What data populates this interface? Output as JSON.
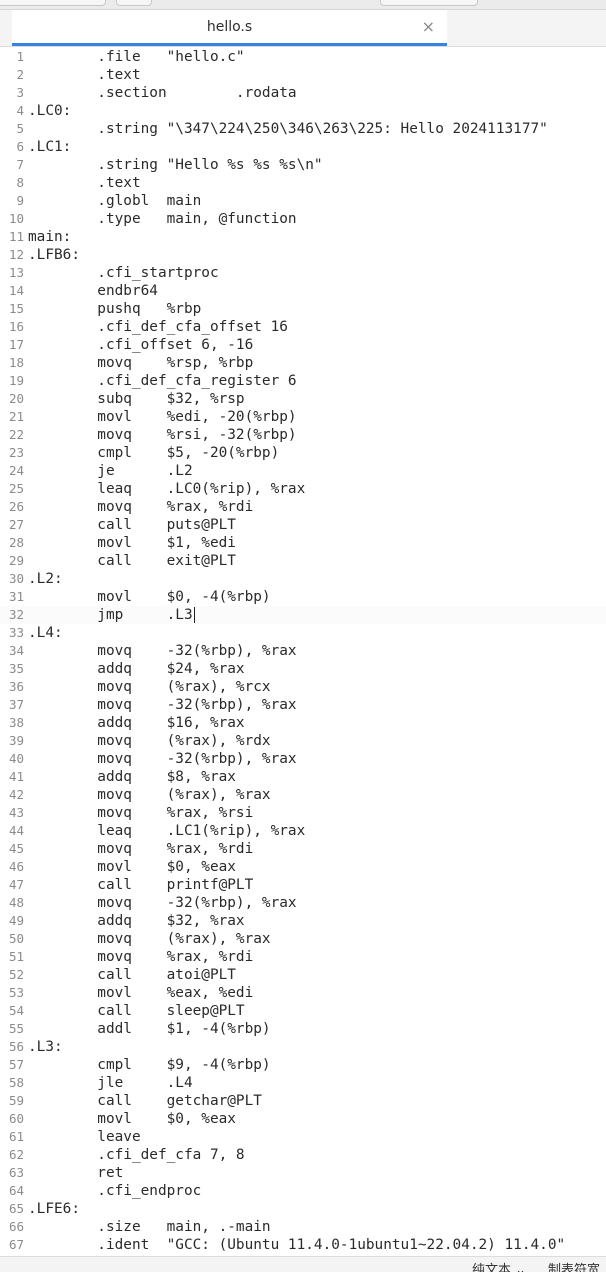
{
  "editor_tab": {
    "title": "hello.s",
    "close_glyph": "×"
  },
  "status_bar": {
    "language": "纯文本 ⌄",
    "tab_width": "制表符宽"
  },
  "cursor_line": 32,
  "lines": [
    "        .file   \"hello.c\"",
    "        .text",
    "        .section        .rodata",
    ".LC0:",
    "        .string \"\\347\\224\\250\\346\\263\\225: Hello 2024113177\"",
    ".LC1:",
    "        .string \"Hello %s %s %s\\n\"",
    "        .text",
    "        .globl  main",
    "        .type   main, @function",
    "main:",
    ".LFB6:",
    "        .cfi_startproc",
    "        endbr64",
    "        pushq   %rbp",
    "        .cfi_def_cfa_offset 16",
    "        .cfi_offset 6, -16",
    "        movq    %rsp, %rbp",
    "        .cfi_def_cfa_register 6",
    "        subq    $32, %rsp",
    "        movl    %edi, -20(%rbp)",
    "        movq    %rsi, -32(%rbp)",
    "        cmpl    $5, -20(%rbp)",
    "        je      .L2",
    "        leaq    .LC0(%rip), %rax",
    "        movq    %rax, %rdi",
    "        call    puts@PLT",
    "        movl    $1, %edi",
    "        call    exit@PLT",
    ".L2:",
    "        movl    $0, -4(%rbp)",
    "        jmp     .L3",
    ".L4:",
    "        movq    -32(%rbp), %rax",
    "        addq    $24, %rax",
    "        movq    (%rax), %rcx",
    "        movq    -32(%rbp), %rax",
    "        addq    $16, %rax",
    "        movq    (%rax), %rdx",
    "        movq    -32(%rbp), %rax",
    "        addq    $8, %rax",
    "        movq    (%rax), %rax",
    "        movq    %rax, %rsi",
    "        leaq    .LC1(%rip), %rax",
    "        movq    %rax, %rdi",
    "        movl    $0, %eax",
    "        call    printf@PLT",
    "        movq    -32(%rbp), %rax",
    "        addq    $32, %rax",
    "        movq    (%rax), %rax",
    "        movq    %rax, %rdi",
    "        call    atoi@PLT",
    "        movl    %eax, %edi",
    "        call    sleep@PLT",
    "        addl    $1, -4(%rbp)",
    ".L3:",
    "        cmpl    $9, -4(%rbp)",
    "        jle     .L4",
    "        call    getchar@PLT",
    "        movl    $0, %eax",
    "        leave",
    "        .cfi_def_cfa 7, 8",
    "        ret",
    "        .cfi_endproc",
    ".LFE6:",
    "        .size   main, .-main",
    "        .ident  \"GCC: (Ubuntu 11.4.0-1ubuntu1~22.04.2) 11.4.0\""
  ]
}
